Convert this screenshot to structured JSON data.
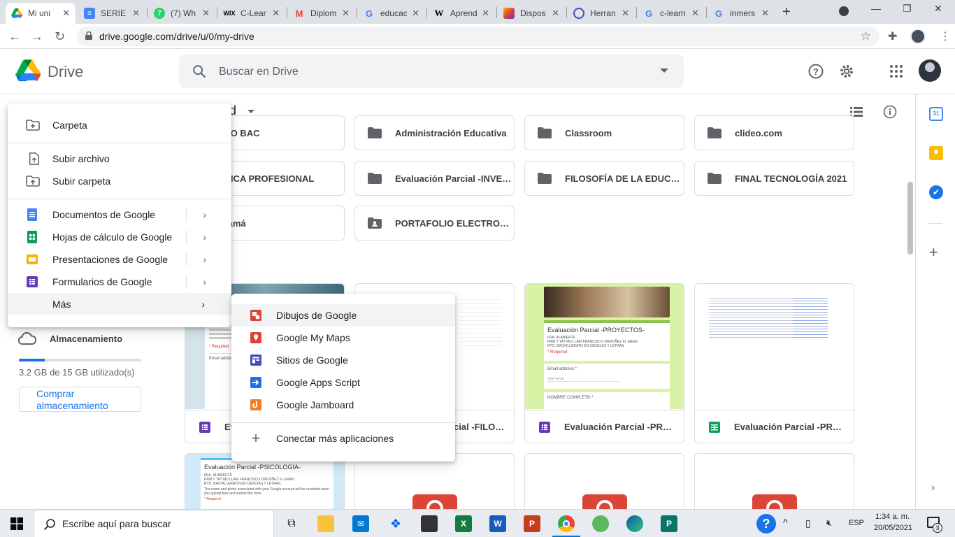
{
  "browser": {
    "tabs": [
      {
        "title": "Mi uni",
        "active": true,
        "icon": "drive-logo"
      },
      {
        "title": "SERIE I",
        "icon": "docs-icon"
      },
      {
        "title": "(7) Wh",
        "icon": "whatsapp-icon"
      },
      {
        "title": "C-Lear",
        "icon": "wix-icon"
      },
      {
        "title": "Diplom",
        "icon": "gmail-icon"
      },
      {
        "title": "educac",
        "icon": "google-icon"
      },
      {
        "title": "Aprend",
        "icon": "wikipedia-icon"
      },
      {
        "title": "Dispos",
        "icon": "slides-gradient-icon"
      },
      {
        "title": "Herran",
        "icon": "globe-icon"
      },
      {
        "title": "c-learn",
        "icon": "google-icon"
      },
      {
        "title": "inmers",
        "icon": "google-icon"
      }
    ],
    "url": "drive.google.com/drive/u/0/my-drive"
  },
  "drive": {
    "app_name": "Drive",
    "search_placeholder": "Buscar en Drive",
    "breadcrumb_fragment": "ad",
    "folders": [
      {
        "name": "TO BAC",
        "icon": "folder"
      },
      {
        "name": "Administración Educativa",
        "icon": "folder"
      },
      {
        "name": "Classroom",
        "icon": "folder"
      },
      {
        "name": "clideo.com",
        "icon": "folder"
      },
      {
        "name": "TICA PROFESIONAL",
        "icon": "folder"
      },
      {
        "name": "Evaluación Parcial -INVESTIGACIÓN",
        "icon": "folder"
      },
      {
        "name": "FILOSOFÍA DE LA EDUCACIÓN",
        "icon": "folder"
      },
      {
        "name": "FINAL TECNOLOGÍA 2021",
        "icon": "folder"
      },
      {
        "name": "lamá",
        "icon": "folder"
      },
      {
        "name": "PORTAFOLIO ELECTRONICO",
        "icon": "shared-folder"
      }
    ],
    "files": [
      {
        "name": "Evaluación Parcial -PSICOLOGÍA",
        "type": "form",
        "visible_name": "Ev"
      },
      {
        "name": "Evaluación Parcial -FILOSOFÍA",
        "type": "sheet",
        "visible_name": "cial -FILOSOFÍA"
      },
      {
        "name": "Evaluación Parcial -PROYECTOS",
        "type": "form"
      },
      {
        "name": "Evaluación Parcial -PROYECTOS",
        "type": "sheet"
      }
    ],
    "form_preview": {
      "title_1": "Evaluación Parcial -PSICOLOGÍA-",
      "title_2": "Evaluación Parcial -PROYECTOS-",
      "line_a": "IIDA. IN ABIERTE",
      "line_b": "PRM Y TAT MU LLAM FRANCISCO ORDOÑEZ FL ERAN",
      "line_c": "RTO. BACHILLERATO EN CIENCIAS Y LETRAS",
      "notice": "The name and photo associated with your Google account will be recorded when you upload files and submit this form.",
      "required": "* Required",
      "email_label": "Email address *",
      "your_email": "Your email",
      "full_name": "NOMBRE COMPLETO *"
    },
    "storage": {
      "label": "Almacenamiento",
      "used_text": "3.2 GB de 15 GB utilizado(s)",
      "used_fraction": 0.21,
      "buy_button": "Comprar almacenamiento"
    }
  },
  "new_menu": {
    "items": [
      {
        "label": "Carpeta",
        "icon": "folder-add-icon"
      },
      {
        "label": "Subir archivo",
        "icon": "file-upload-icon"
      },
      {
        "label": "Subir carpeta",
        "icon": "folder-upload-icon"
      },
      {
        "label": "Documentos de Google",
        "icon": "docs-icon",
        "color": "#4285f4"
      },
      {
        "label": "Hojas de cálculo de Google",
        "icon": "sheets-icon",
        "color": "#0f9d58"
      },
      {
        "label": "Presentaciones de Google",
        "icon": "slides-icon",
        "color": "#f4b400"
      },
      {
        "label": "Formularios de Google",
        "icon": "forms-icon",
        "color": "#673ab7"
      },
      {
        "label": "Más"
      }
    ]
  },
  "more_menu": {
    "items": [
      {
        "label": "Dibujos de Google",
        "icon": "drawings-icon",
        "color": "#db4437"
      },
      {
        "label": "Google My Maps",
        "icon": "my-maps-icon",
        "color": "#db4437"
      },
      {
        "label": "Sitios de Google",
        "icon": "sites-icon",
        "color": "#3f51b5"
      },
      {
        "label": "Google Apps Script",
        "icon": "apps-script-icon",
        "color": "#1a73e8"
      },
      {
        "label": "Google Jamboard",
        "icon": "jamboard-icon",
        "color": "#f37c20"
      },
      {
        "label": "Conectar más aplicaciones",
        "icon": "plus-icon"
      }
    ]
  },
  "taskbar": {
    "search_placeholder": "Escribe aquí para buscar",
    "language": "ESP",
    "time": "1:34 a. m.",
    "date": "20/05/2021",
    "notification_count": "3"
  },
  "colors": {
    "accent": "#1a73e8",
    "menu_highlight": "#f1f3f4"
  }
}
